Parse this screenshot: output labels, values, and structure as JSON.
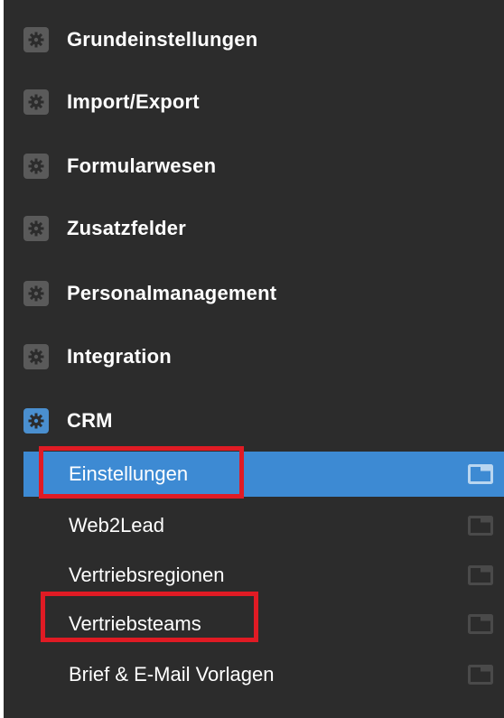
{
  "sections": [
    {
      "label": "Grundeinstellungen",
      "icon": "gear-icon"
    },
    {
      "label": "Import/Export",
      "icon": "gear-icon"
    },
    {
      "label": "Formularwesen",
      "icon": "gear-icon"
    },
    {
      "label": "Zusatzfelder",
      "icon": "gear-icon"
    },
    {
      "label": "Personalmanagement",
      "icon": "gear-icon"
    },
    {
      "label": "Integration",
      "icon": "gear-icon"
    },
    {
      "label": "CRM",
      "icon": "gear-icon",
      "active": true
    }
  ],
  "crm_items": [
    {
      "label": "Einstellungen",
      "selected": true,
      "icon": "open-window-icon"
    },
    {
      "label": "Web2Lead",
      "icon": "open-window-icon"
    },
    {
      "label": "Vertriebsregionen",
      "icon": "open-window-icon"
    },
    {
      "label": "Vertriebsteams",
      "icon": "open-window-icon"
    },
    {
      "label": "Brief & E-Mail Vorlagen",
      "icon": "open-window-icon"
    }
  ],
  "colors": {
    "sidebar_bg": "#2c2c2c",
    "selected_bg": "#3d8ad3",
    "active_icon": "#4a8fcf",
    "highlight": "#e01b24"
  }
}
